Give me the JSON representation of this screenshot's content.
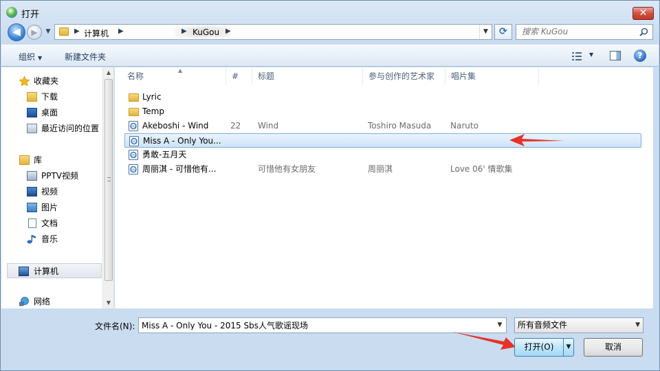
{
  "window": {
    "title": "打开",
    "close": "✕"
  },
  "nav": {
    "back": "◀",
    "forward": "▶",
    "history": "▼",
    "breadcrumb": [
      "计算机",
      "KuGou"
    ],
    "search_placeholder": "搜索 KuGou"
  },
  "toolbar": {
    "organize": "组织",
    "new_folder": "新建文件夹",
    "help": "?"
  },
  "sidebar": {
    "favorites": {
      "label": "收藏夹",
      "items": [
        "下载",
        "桌面",
        "最近访问的位置"
      ]
    },
    "libraries": {
      "label": "库",
      "items": [
        "PPTV视频",
        "视频",
        "图片",
        "文档",
        "音乐"
      ]
    },
    "computer": "计算机",
    "network": "网络"
  },
  "columns": [
    "名称",
    "#",
    "标题",
    "参与创作的艺术家",
    "唱片集"
  ],
  "files": [
    {
      "type": "folder",
      "name": "Lyric",
      "num": "",
      "title": "",
      "artist": "",
      "album": ""
    },
    {
      "type": "folder",
      "name": "Temp",
      "num": "",
      "title": "",
      "artist": "",
      "album": ""
    },
    {
      "type": "audio",
      "name": "Akeboshi - Wind",
      "num": "22",
      "title": "Wind",
      "artist": "Toshiro Masuda",
      "album": "Naruto"
    },
    {
      "type": "audio",
      "name": "Miss A - Only You...",
      "num": "",
      "title": "",
      "artist": "",
      "album": "",
      "selected": true
    },
    {
      "type": "audio",
      "name": "勇敢-五月天",
      "num": "",
      "title": "",
      "artist": "",
      "album": ""
    },
    {
      "type": "audio",
      "name": "周丽淇 - 可惜他有...",
      "num": "",
      "title": "可惜他有女朋友",
      "artist": "周丽淇",
      "album": "Love 06' 情歌集"
    }
  ],
  "footer": {
    "filename_label": "文件名(N):",
    "filename_value": "Miss A - Only You - 2015 Sbs人气歌谣现场",
    "filter": "所有音频文件",
    "open": "打开(O)",
    "cancel": "取消"
  },
  "colors": {
    "accent": "#3c7fb1",
    "selection": "#cde4f7",
    "annotation_arrow": "#e8312a"
  }
}
